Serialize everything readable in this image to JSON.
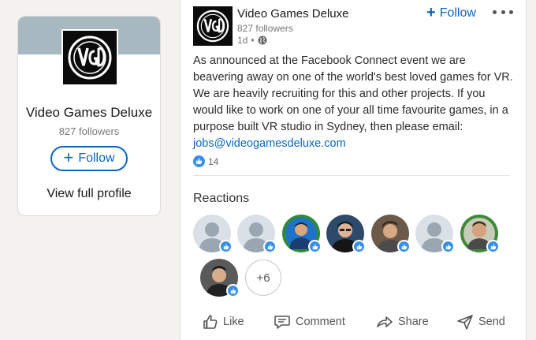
{
  "profile_card": {
    "name": "Video Games Deluxe",
    "followers": "827 followers",
    "follow_label": "Follow",
    "view_profile_label": "View full profile"
  },
  "post": {
    "company_name": "Video Games Deluxe",
    "followers": "827 followers",
    "time": "1d",
    "time_separator": "•",
    "follow_label": "Follow",
    "body": "As announced at the Facebook Connect event we are beavering away on one of the world's best loved games for VR. We are heavily recruiting for this and other projects. If you would like to work on one of your all time favourite games, in a purpose built VR studio in Sydney, then please email:",
    "email": "jobs@videogamesdeluxe.com",
    "reaction_count": "14"
  },
  "reactions": {
    "title": "Reactions",
    "more_count": "+6",
    "avatars": [
      {
        "kind": "placeholder"
      },
      {
        "kind": "placeholder"
      },
      {
        "kind": "photo"
      },
      {
        "kind": "photo"
      },
      {
        "kind": "photo"
      },
      {
        "kind": "placeholder"
      },
      {
        "kind": "photo"
      },
      {
        "kind": "photo"
      }
    ]
  },
  "actions": {
    "like": "Like",
    "comment": "Comment",
    "share": "Share",
    "send": "Send"
  },
  "colors": {
    "accent": "#0a66c2",
    "like_blue": "#378fe9",
    "background": "#f3f2ef"
  },
  "icons": [
    "globe-icon",
    "like-icon",
    "comment-icon",
    "share-icon",
    "send-icon",
    "more-icon"
  ]
}
